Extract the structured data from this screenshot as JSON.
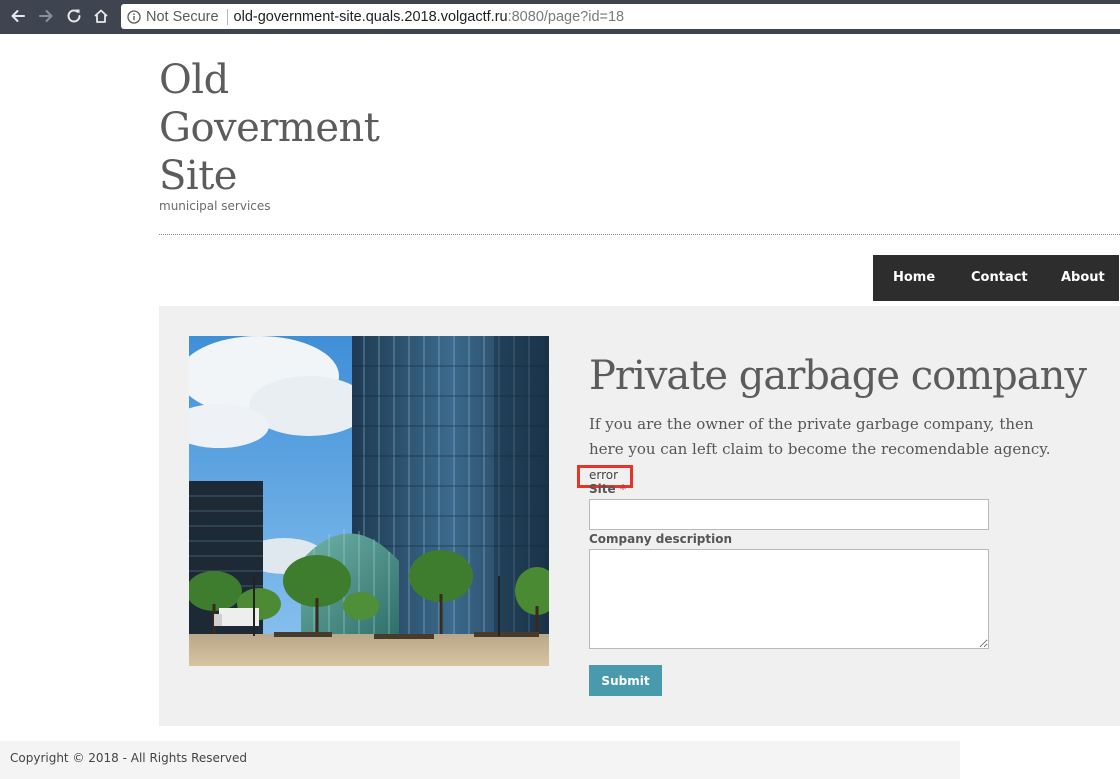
{
  "browser": {
    "security_label": "Not Secure",
    "url_host": "old-government-site.quals.2018.volgactf.ru",
    "url_rest": ":8080/page?id=18"
  },
  "header": {
    "title_lines": [
      "Old",
      "Goverment",
      "Site"
    ],
    "subtitle": "municipal services"
  },
  "nav": {
    "items": [
      {
        "label": "Home"
      },
      {
        "label": "Contact"
      },
      {
        "label": "About"
      }
    ]
  },
  "page": {
    "heading": "Private garbage company",
    "intro": "If you are the owner of the private garbage company, then here you can left claim to become the recomendable agency.",
    "error": "error"
  },
  "form": {
    "site_label": "Site",
    "site_required_mark": "*",
    "site_value": "",
    "description_label": "Company description",
    "description_value": "",
    "submit_label": "Submit"
  },
  "footer": {
    "copyright": "Copyright © 2018 - All Rights Reserved"
  },
  "colors": {
    "chrome": "#3f4550",
    "nav_bg": "#2d2d2d",
    "panel_bg": "#f0f0f0",
    "submit_bg": "#4a9aae",
    "error_highlight": "#e8332b",
    "title_text": "#5c5c5c"
  }
}
